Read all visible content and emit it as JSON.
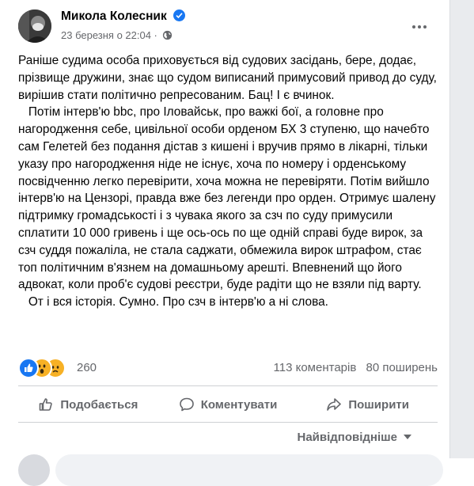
{
  "post": {
    "author": "Микола Колесник",
    "timestamp": "23 березня о 22:04 ·",
    "paragraphs": [
      "Раніше судима особа приховується від судових засідань, бере, додає, прізвище дружини, знає що судом виписаний примусовий привод до суду, вирішив стати політично репресованим. Бац! І є вчинок.",
      "   Потім інтерв'ю bbc, про Іловайськ, про важкі бої, а головне про нагородження себе, цивільної особи орденом БХ 3 ступеню, що начебто сам Гелетей без подання дістав з кишені і вручив прямо в лікарні, тільки указу про нагородження ніде не існує, хоча по номеру і орденському посвідченню легко перевірити, хоча можна не перевіряти. Потім вийшло інтерв'ю на Цензорі, правда вже без легенди про орден. Отримує шалену підтримку громадськості і з чувака якого за сзч по суду примусили сплатити 10 000 гривень і ще ось-ось по ще одній справі буде вирок, за сзч суддя пожаліла, не стала саджати, обмежила вирок штрафом, стає топ політичним в'язнем на домашньому арешті. Впевнений що його адвокат, коли проб'є судові реєстри, буде радіти що не взяли під варту.",
      "   От і вся історія. Сумно. Про сзч в інтерв'ю а ні слова."
    ]
  },
  "stats": {
    "reactions_count": "260",
    "comments": "113 коментарів",
    "shares": "80 поширень"
  },
  "actions": {
    "like": "Подобається",
    "comment": "Коментувати",
    "share": "Поширити"
  },
  "comments_sort": "Найвідповідніше",
  "colors": {
    "accent": "#1877f2",
    "secondary_text": "#65676b",
    "divider": "#ced0d4"
  },
  "icons": {
    "verified": "verified-badge-icon",
    "audience": "globe-icon",
    "more": "more-options-icon",
    "like": "thumbs-up-icon",
    "comment": "comment-bubble-icon",
    "share": "share-arrow-icon"
  }
}
